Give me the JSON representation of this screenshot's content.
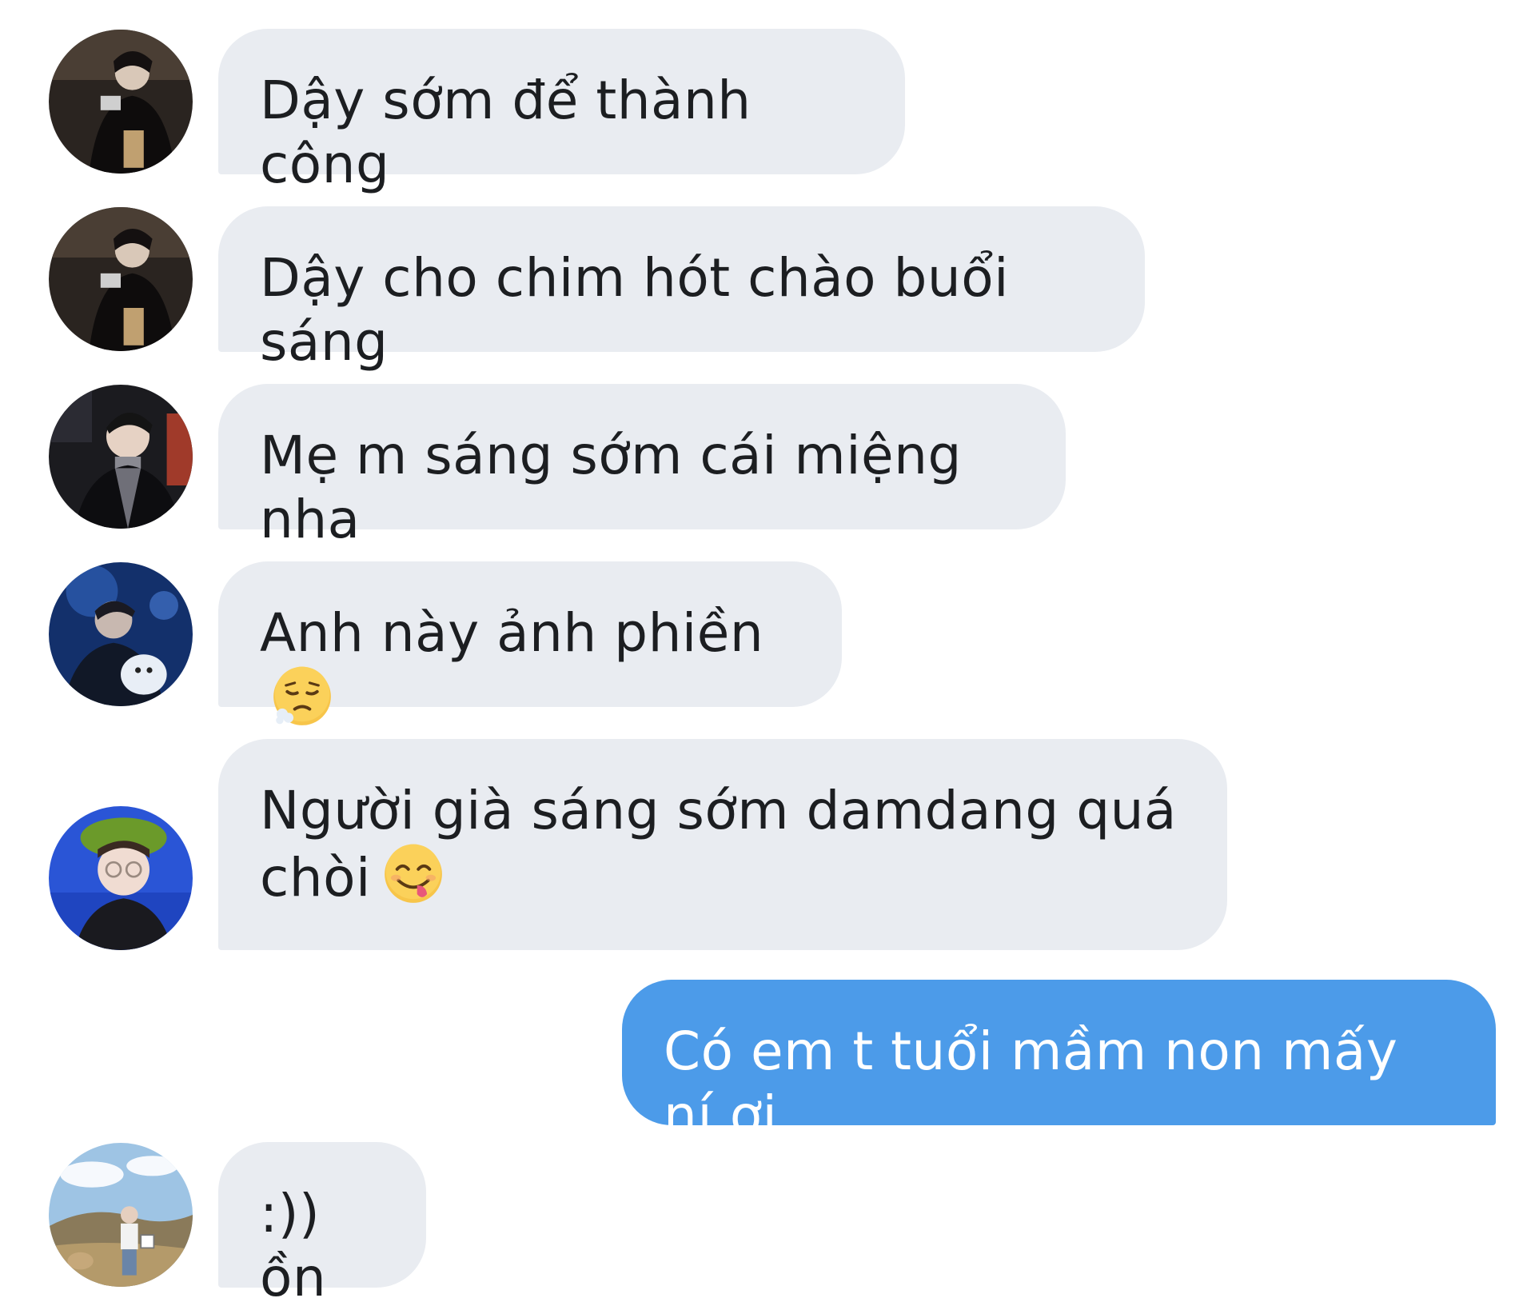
{
  "conversation": {
    "messages": [
      {
        "sender": "incoming",
        "avatar_icon": "avatar-dark-photo-icon",
        "text": "Dậy sớm để thành công"
      },
      {
        "sender": "incoming",
        "avatar_icon": "avatar-dark-photo-icon",
        "text": "Dậy cho chim hót chào buổi sáng"
      },
      {
        "sender": "incoming",
        "avatar_icon": "avatar-man-turtleneck-icon",
        "text": "Mẹ m sáng sớm cái miệng nha"
      },
      {
        "sender": "incoming",
        "avatar_icon": "avatar-blue-concert-icon",
        "text": "Anh này ảnh phiền",
        "emoji_icon": "tired-face-emoji-icon"
      },
      {
        "sender": "incoming",
        "avatar_icon": "avatar-green-hat-icon",
        "line1": "Người già sáng sớm damdang quá",
        "line2": "chòi",
        "emoji_icon": "yum-face-emoji-icon"
      },
      {
        "sender": "outgoing",
        "text": "Có em t tuổi mầm non mấy ní ơi"
      },
      {
        "sender": "incoming",
        "avatar_icon": "avatar-field-sky-icon",
        "text": ":)) ồn"
      }
    ]
  },
  "colors": {
    "incoming_bubble": "#e9ecf1",
    "outgoing_bubble": "#4c9be9",
    "incoming_text": "#1c1e21",
    "outgoing_text": "#ffffff"
  }
}
